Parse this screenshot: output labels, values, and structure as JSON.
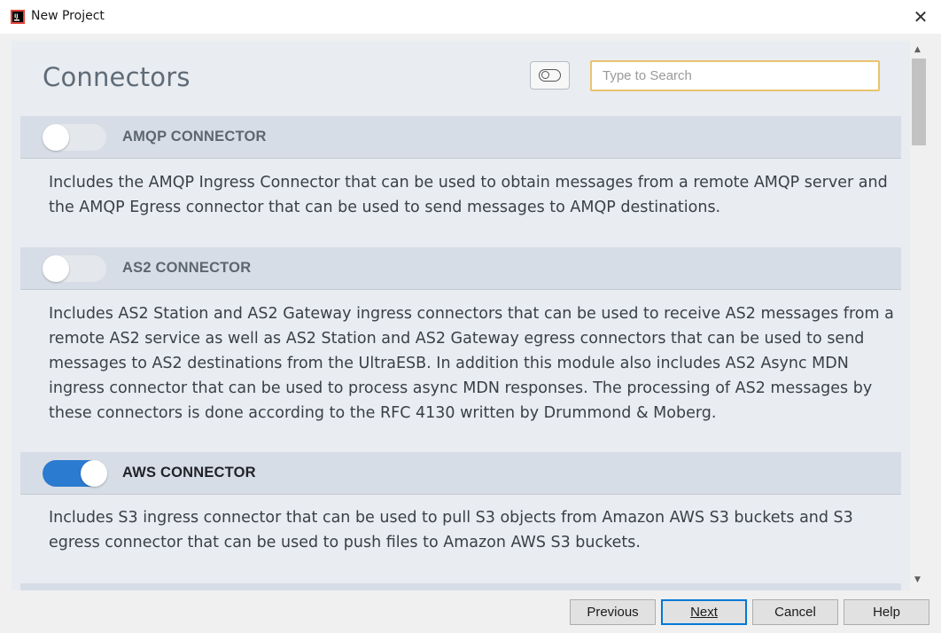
{
  "window": {
    "title": "New Project",
    "close_glyph": "✕"
  },
  "page": {
    "heading": "Connectors"
  },
  "search": {
    "placeholder": "Type to Search",
    "value": ""
  },
  "sections": [
    {
      "label": "AMQP CONNECTOR",
      "enabled": false,
      "description": "Includes the AMQP Ingress Connector that can be used to obtain messages from a remote AMQP server and the AMQP Egress connector that can be used to send messages to AMQP destinations."
    },
    {
      "label": "AS2 CONNECTOR",
      "enabled": false,
      "description": "Includes AS2 Station and AS2 Gateway ingress connectors that can be used to receive AS2 messages from a remote AS2 service as well as AS2 Station and AS2 Gateway egress connectors that can be used to send messages to AS2 destinations from the UltraESB. In addition this module also includes AS2 Async MDN ingress connector that can be used to process async MDN responses. The processing of AS2 messages by these connectors is done according to the RFC 4130 written by Drummond & Moberg."
    },
    {
      "label": "AWS CONNECTOR",
      "enabled": true,
      "description": "Includes S3 ingress connector that can be used to pull S3 objects from Amazon AWS S3 buckets and S3 egress connector that can be used to push files to Amazon AWS S3 buckets."
    }
  ],
  "footer": {
    "previous_label": "Previous",
    "next_label": "Next",
    "cancel_label": "Cancel",
    "help_label": "Help"
  },
  "scrollbar": {
    "up_glyph": "▲",
    "down_glyph": "▼"
  },
  "colors": {
    "accent": "#2b7bd0",
    "search_focus": "#e8c46f",
    "panel_bg": "#e9ecf1"
  },
  "icons": {
    "app": "intellij-idea-icon",
    "close": "close-icon",
    "view_toggle": "toggle-icon"
  }
}
